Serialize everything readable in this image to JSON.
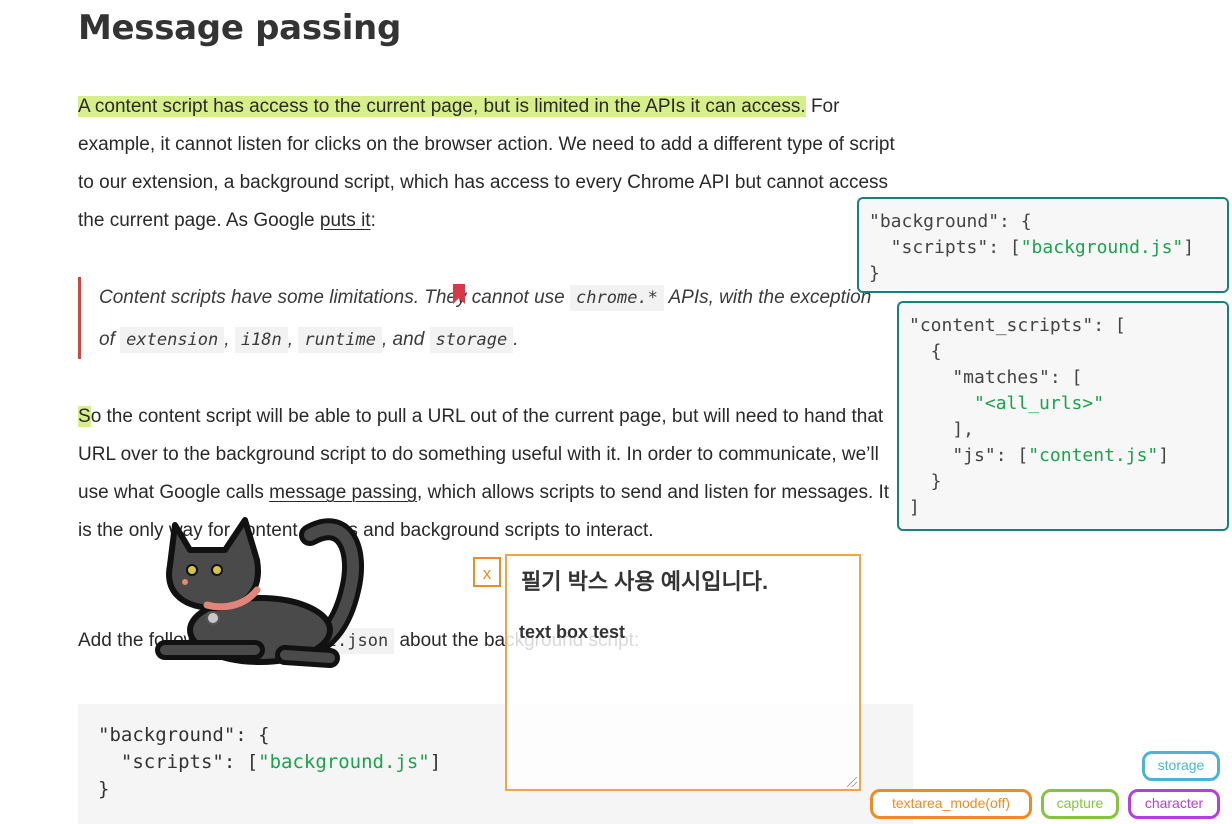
{
  "article": {
    "heading": "Message passing",
    "p1": {
      "highlighted": "A content script has access to the current page, but is limited in the APIs it can access.",
      "rest": "For example, it cannot listen for clicks on the browser action. We need to add a different type of script to our extension, a background script, which has access to every Chrome API but cannot access the current page. As Google",
      "link": "puts it",
      "end": ":"
    },
    "quote": {
      "before": "Content scripts have some limitations. They cannot use",
      "code1": "chrome.*",
      "after1": "APIs, with the exception of",
      "code2": "extension",
      "sep1": ",",
      "code3": "i18n",
      "sep2": ",",
      "code4": "runtime",
      "sep3": ", and",
      "code5": "storage",
      "end": "."
    },
    "p2": {
      "first_letter": "S",
      "text1": "o the content script will be able to pull a URL out of the current page, but will need to hand that URL over to the background script to do something useful with it. In order to communicate, we’ll use what Google calls",
      "link": "message passing",
      "text2": ", which allows scripts to send and listen for messages. It is the only way for content scripts and background scripts to interact."
    },
    "p3": {
      "before": "Add the following to",
      "code": "manifest.json",
      "after": "about the background script:"
    },
    "codeblock": {
      "line1_key": "\"background\": {",
      "line2_key": "  \"scripts\": [",
      "line2_str": "\"background.js\"",
      "line2_end": "]",
      "line3": "}"
    }
  },
  "popups": {
    "background": {
      "line1": "\"background\": {",
      "line2_key": "  \"scripts\": [",
      "line2_str": "\"background.js\"",
      "line2_end": "]",
      "line3": "}"
    },
    "content_scripts": {
      "line1": "\"content_scripts\": [",
      "line2": "  {",
      "line3": "    \"matches\": [",
      "line4_str": "      \"<all_urls>\"",
      "line5": "    ],",
      "line6_key": "    \"js\": [",
      "line6_str": "\"content.js\"",
      "line6_end": "]",
      "line7": "  }",
      "line8": "]"
    }
  },
  "notebox": {
    "close_label": "x",
    "title": "필기 박스 사용 예시입니다.",
    "body": "text box test"
  },
  "toolbar_pills": {
    "storage": "storage",
    "textarea_mode": "textarea_mode(off)",
    "capture": "capture",
    "character": "character"
  },
  "colors": {
    "highlight": "#d7ef8a",
    "popup_border": "#17827d",
    "string_green": "#1aa34a",
    "notebox_orange": "#f4a24a",
    "quote_border": "#d0453f"
  },
  "icons": {
    "bookmark": "bookmark-icon",
    "cat": "cat-sticker",
    "resize": "resize-grip-icon"
  }
}
